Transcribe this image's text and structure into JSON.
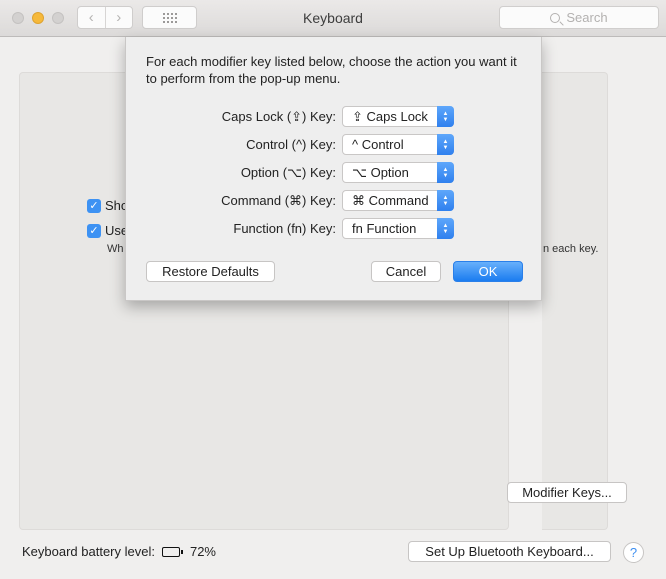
{
  "window": {
    "title": "Keyboard",
    "search_placeholder": "Search",
    "nav_back": "‹",
    "nav_forward": "›"
  },
  "background": {
    "checkbox_1_label": "Sho",
    "checkbox_1_checked": true,
    "checkbox_2_label": "Use",
    "checkbox_2_checked": true,
    "hint_left": "Wh",
    "hint_right": "n each key.",
    "modifier_keys_button": "Modifier Keys..."
  },
  "footer": {
    "battery_label": "Keyboard battery level:",
    "battery_percent": "72%",
    "battery_level": 0.72,
    "bluetooth_button": "Set Up Bluetooth Keyboard...",
    "help_button": "?"
  },
  "sheet": {
    "description": "For each modifier key listed below, choose the action you want it to perform from the pop-up menu.",
    "rows": [
      {
        "label": "Caps Lock (⇪) Key:",
        "value": "⇪ Caps Lock"
      },
      {
        "label": "Control (^) Key:",
        "value": "^ Control"
      },
      {
        "label": "Option (⌥) Key:",
        "value": "⌥ Option"
      },
      {
        "label": "Command (⌘) Key:",
        "value": "⌘ Command"
      },
      {
        "label": "Function (fn) Key:",
        "value": "fn Function"
      }
    ],
    "restore_defaults": "Restore Defaults",
    "cancel": "Cancel",
    "ok": "OK"
  }
}
